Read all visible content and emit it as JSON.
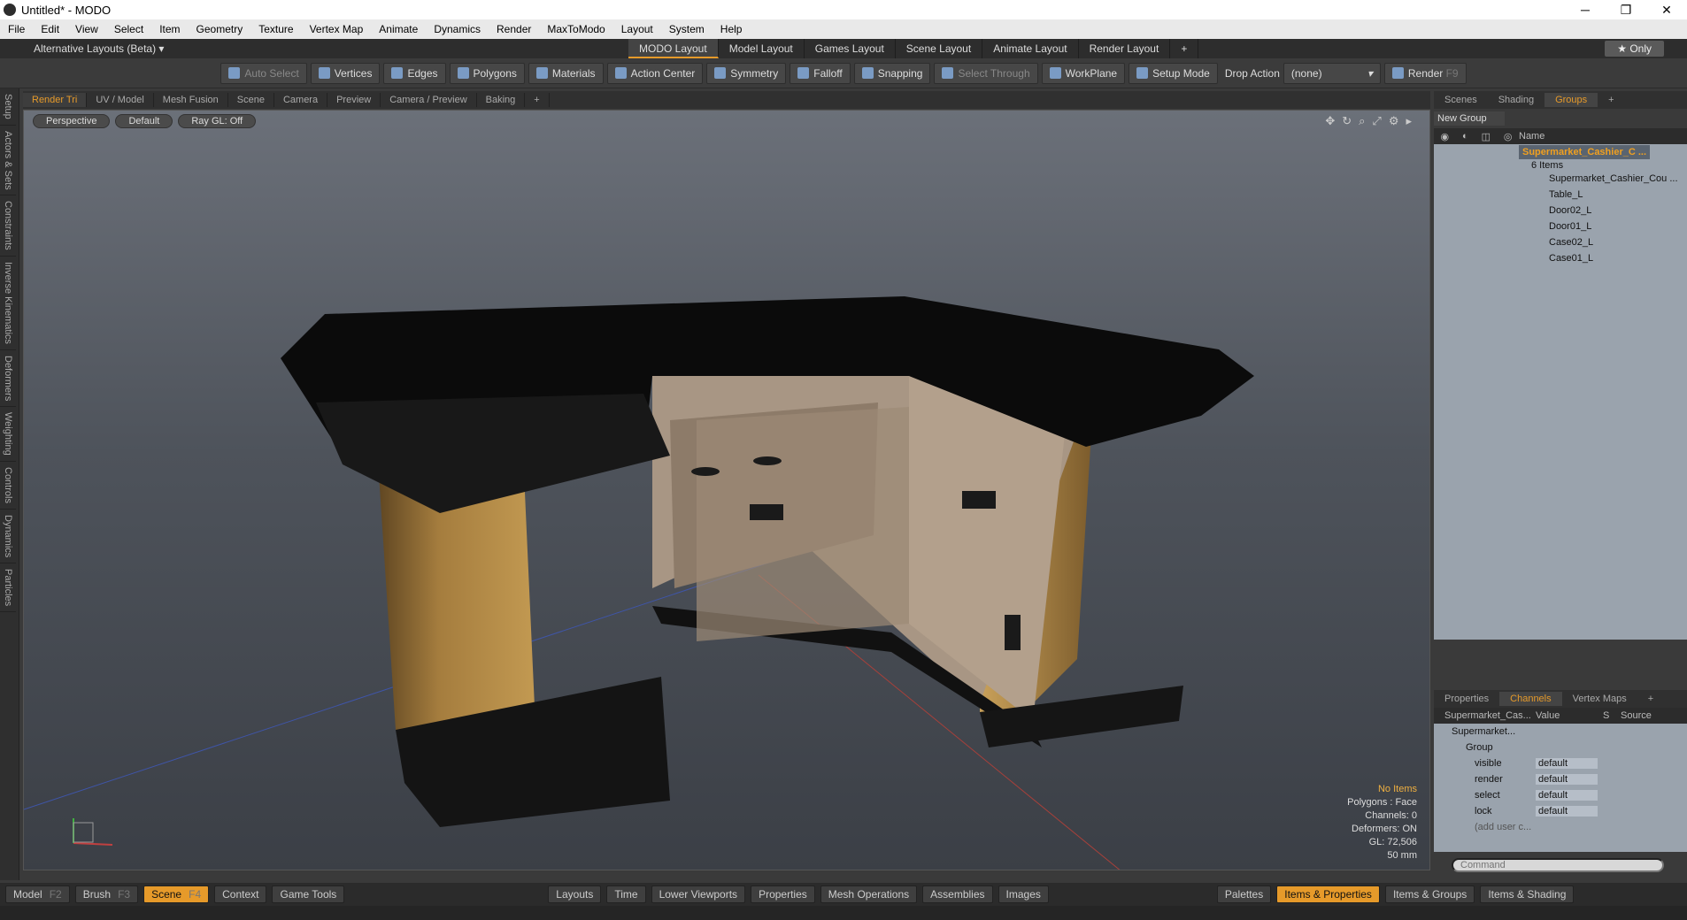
{
  "title": "Untitled* - MODO",
  "menu": [
    "File",
    "Edit",
    "View",
    "Select",
    "Item",
    "Geometry",
    "Texture",
    "Vertex Map",
    "Animate",
    "Dynamics",
    "Render",
    "MaxToModo",
    "Layout",
    "System",
    "Help"
  ],
  "alt_layouts": "Alternative Layouts (Beta) ▾",
  "layout_tabs": [
    "MODO Layout",
    "Model Layout",
    "Games Layout",
    "Scene Layout",
    "Animate Layout",
    "Render Layout",
    "+"
  ],
  "only_label": "★  Only",
  "toolbar": [
    "Auto Select",
    "Vertices",
    "Edges",
    "Polygons",
    "Materials",
    "Action Center",
    "Symmetry",
    "Falloff",
    "Snapping",
    "Select Through",
    "WorkPlane",
    "Setup Mode"
  ],
  "drop_action_label": "Drop Action",
  "drop_action_value": "(none)",
  "render_label": "Render",
  "render_key": "F9",
  "left_tabs": [
    "Setup",
    "Actors & Sets",
    "Constraints",
    "Inverse Kinematics",
    "Deformers",
    "Weighting",
    "Controls",
    "Dynamics",
    "Particles"
  ],
  "viewport_tabs": [
    "Render Tri",
    "UV / Model",
    "Mesh Fusion",
    "Scene",
    "Camera",
    "Preview",
    "Camera / Preview",
    "Baking",
    "+"
  ],
  "viewport_head": [
    "Perspective",
    "Default",
    "Ray GL: Off"
  ],
  "info": {
    "l1": "No Items",
    "l2": "Polygons : Face",
    "l3": "Channels: 0",
    "l4": "Deformers: ON",
    "l5": "GL: 72,506",
    "l6": "50 mm"
  },
  "right_tabs": [
    "Scenes",
    "Shading",
    "Groups",
    "+"
  ],
  "new_group": "New Group",
  "name_col": "Name",
  "group_name": "Supermarket_Cashier_C ...",
  "group_count": "6 Items",
  "group_children": [
    "Supermarket_Cashier_Cou ...",
    "Table_L",
    "Door02_L",
    "Door01_L",
    "Case02_L",
    "Case01_L"
  ],
  "channel_tabs": [
    "Properties",
    "Channels",
    "Vertex Maps",
    "+"
  ],
  "channel_head": [
    "Supermarket_Cas...",
    "Value",
    "S",
    "Source"
  ],
  "channel_item": "Supermarket...",
  "channel_group": "Group",
  "channels": [
    {
      "n": "visible",
      "v": "default"
    },
    {
      "n": "render",
      "v": "default"
    },
    {
      "n": "select",
      "v": "default"
    },
    {
      "n": "lock",
      "v": "default"
    }
  ],
  "add_user": "(add user c...",
  "command_placeholder": "Command",
  "status_left": [
    {
      "l": "Model",
      "k": "F2"
    },
    {
      "l": "Brush",
      "k": "F3"
    },
    {
      "l": "Scene",
      "k": "F4"
    },
    {
      "l": "Context",
      "k": ""
    },
    {
      "l": "Game Tools",
      "k": ""
    }
  ],
  "status_mid": [
    "Layouts",
    "Time",
    "Lower Viewports",
    "Properties",
    "Mesh Operations",
    "Assemblies",
    "Images"
  ],
  "status_right": [
    "Palettes",
    "Items & Properties",
    "Items & Groups",
    "Items & Shading"
  ]
}
